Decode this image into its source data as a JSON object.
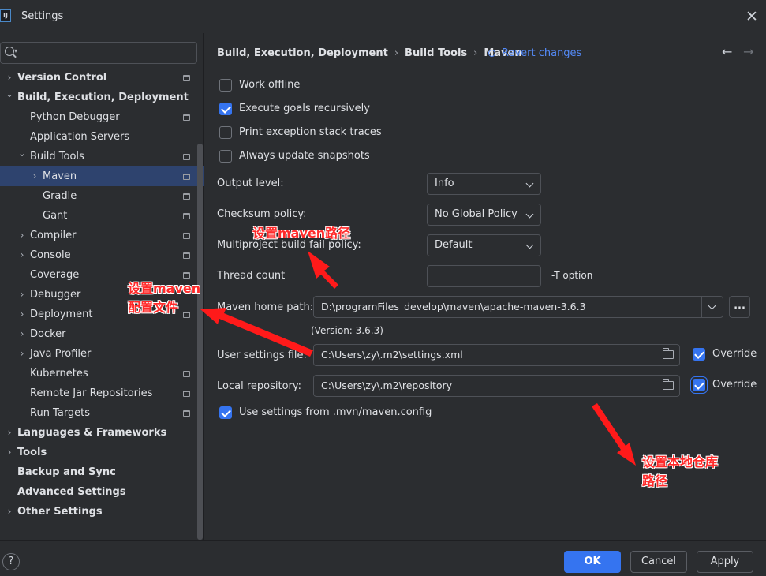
{
  "window": {
    "title": "Settings",
    "app_icon_text": "IJ",
    "close_glyph": "✕"
  },
  "sidebar": {
    "search_placeholder": "",
    "items": [
      {
        "label": "Version Control",
        "bold": true,
        "chevron": "›",
        "level": 0,
        "project_icon": true
      },
      {
        "label": "Build, Execution, Deployment",
        "bold": true,
        "chevron": "⌄",
        "level": 0,
        "project_icon": false
      },
      {
        "label": "Python Debugger",
        "bold": false,
        "chevron": "",
        "level": 1,
        "project_icon": true
      },
      {
        "label": "Application Servers",
        "bold": false,
        "chevron": "",
        "level": 1,
        "project_icon": false
      },
      {
        "label": "Build Tools",
        "bold": false,
        "chevron": "⌄",
        "level": 1,
        "project_icon": true
      },
      {
        "label": "Maven",
        "bold": false,
        "chevron": "›",
        "level": 2,
        "project_icon": true,
        "selected": true
      },
      {
        "label": "Gradle",
        "bold": false,
        "chevron": "",
        "level": 2,
        "project_icon": true
      },
      {
        "label": "Gant",
        "bold": false,
        "chevron": "",
        "level": 2,
        "project_icon": true
      },
      {
        "label": "Compiler",
        "bold": false,
        "chevron": "›",
        "level": 1,
        "project_icon": true
      },
      {
        "label": "Console",
        "bold": false,
        "chevron": "›",
        "level": 1,
        "project_icon": true
      },
      {
        "label": "Coverage",
        "bold": false,
        "chevron": "",
        "level": 1,
        "project_icon": true
      },
      {
        "label": "Debugger",
        "bold": false,
        "chevron": "›",
        "level": 1,
        "project_icon": false
      },
      {
        "label": "Deployment",
        "bold": false,
        "chevron": "›",
        "level": 1,
        "project_icon": true
      },
      {
        "label": "Docker",
        "bold": false,
        "chevron": "›",
        "level": 1,
        "project_icon": false
      },
      {
        "label": "Java Profiler",
        "bold": false,
        "chevron": "›",
        "level": 1,
        "project_icon": false
      },
      {
        "label": "Kubernetes",
        "bold": false,
        "chevron": "",
        "level": 1,
        "project_icon": true
      },
      {
        "label": "Remote Jar Repositories",
        "bold": false,
        "chevron": "",
        "level": 1,
        "project_icon": true
      },
      {
        "label": "Run Targets",
        "bold": false,
        "chevron": "",
        "level": 1,
        "project_icon": true
      },
      {
        "label": "Languages & Frameworks",
        "bold": true,
        "chevron": "›",
        "level": 0,
        "project_icon": false
      },
      {
        "label": "Tools",
        "bold": true,
        "chevron": "›",
        "level": 0,
        "project_icon": false
      },
      {
        "label": "Backup and Sync",
        "bold": true,
        "chevron": "",
        "level": 0,
        "project_icon": false
      },
      {
        "label": "Advanced Settings",
        "bold": true,
        "chevron": "",
        "level": 0,
        "project_icon": false
      },
      {
        "label": "Other Settings",
        "bold": true,
        "chevron": "›",
        "level": 0,
        "project_icon": false
      }
    ]
  },
  "breadcrumb": {
    "parts": [
      "Build, Execution, Deployment",
      "Build Tools",
      "Maven"
    ],
    "separator": "›",
    "revert_label": "Revert changes",
    "back_glyph": "←",
    "forward_glyph": "→"
  },
  "options": {
    "work_offline": {
      "label": "Work offline",
      "checked": false
    },
    "execute_goals": {
      "label": "Execute goals recursively",
      "checked": true
    },
    "print_exception": {
      "label": "Print exception stack traces",
      "checked": false
    },
    "always_update": {
      "label": "Always update snapshots",
      "checked": false
    }
  },
  "fields": {
    "output_level": {
      "label": "Output level:",
      "value": "Info"
    },
    "checksum_policy": {
      "label": "Checksum policy:",
      "value": "No Global Policy"
    },
    "multiproject_policy": {
      "label": "Multiproject build fail policy:",
      "value": "Default"
    },
    "thread_count": {
      "label": "Thread count",
      "value": "",
      "hint": "-T option"
    },
    "maven_home": {
      "label": "Maven home path:",
      "value": "D:\\programFiles_develop\\maven\\apache-maven-3.6.3",
      "version": "(Version: 3.6.3)",
      "browse_label": "..."
    },
    "user_settings": {
      "label": "User settings file:",
      "value": "C:\\Users\\zy\\.m2\\settings.xml",
      "override_label": "Override",
      "override_checked": true
    },
    "local_repo": {
      "label": "Local repository:",
      "value": "C:\\Users\\zy\\.m2\\repository",
      "override_label": "Override",
      "override_checked": true
    },
    "use_mvn_config": {
      "label": "Use settings from .mvn/maven.config",
      "checked": true
    }
  },
  "annotations": {
    "maven_path": "设置maven路径",
    "maven_config_line1": "设置maven",
    "maven_config_line2": "配置文件",
    "local_repo_line1": "设置本地仓库",
    "local_repo_line2": "路径",
    "color": "#ff2a2a"
  },
  "footer": {
    "help_glyph": "?",
    "ok_label": "OK",
    "cancel_label": "Cancel",
    "apply_label": "Apply"
  },
  "colors": {
    "background": "#2b2d30",
    "accent": "#3574f0",
    "selection": "#2e436e",
    "link": "#548af7"
  }
}
